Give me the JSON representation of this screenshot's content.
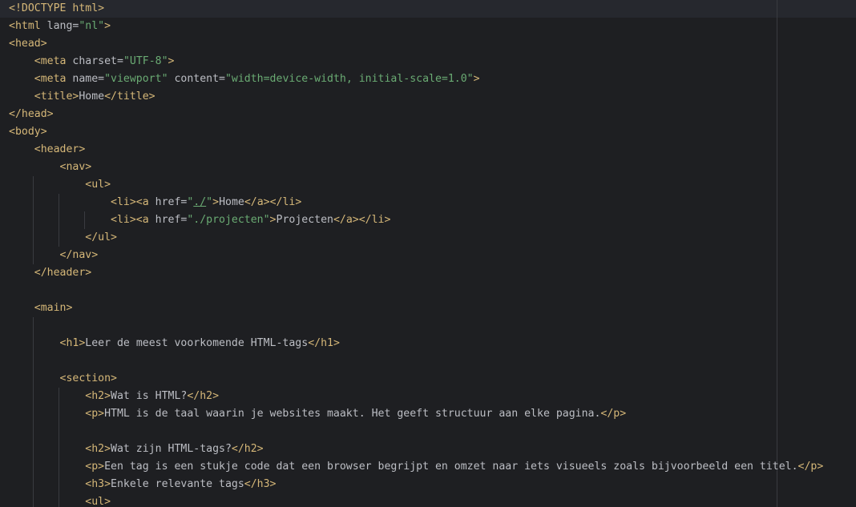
{
  "editor": {
    "language": "html",
    "colors": {
      "background": "#1e1f22",
      "current_line": "#26282e",
      "tag": "#d5b778",
      "attribute": "#bcbec4",
      "value": "#6aab73",
      "text": "#bcbec4"
    },
    "lines": [
      [
        {
          "k": "t",
          "s": "<!DOCTYPE html>"
        }
      ],
      [
        {
          "k": "t",
          "s": "<html "
        },
        {
          "k": "a",
          "s": "lang="
        },
        {
          "k": "v",
          "s": "\"nl\""
        },
        {
          "k": "t",
          "s": ">"
        }
      ],
      [
        {
          "k": "t",
          "s": "<head>"
        }
      ],
      [
        {
          "k": "x",
          "s": "    "
        },
        {
          "k": "t",
          "s": "<meta "
        },
        {
          "k": "a",
          "s": "charset="
        },
        {
          "k": "v",
          "s": "\"UTF-8\""
        },
        {
          "k": "t",
          "s": ">"
        }
      ],
      [
        {
          "k": "x",
          "s": "    "
        },
        {
          "k": "t",
          "s": "<meta "
        },
        {
          "k": "a",
          "s": "name="
        },
        {
          "k": "v",
          "s": "\"viewport\""
        },
        {
          "k": "a",
          "s": " content="
        },
        {
          "k": "v",
          "s": "\"width=device-width, initial-scale=1.0\""
        },
        {
          "k": "t",
          "s": ">"
        }
      ],
      [
        {
          "k": "x",
          "s": "    "
        },
        {
          "k": "t",
          "s": "<title>"
        },
        {
          "k": "x",
          "s": "Home"
        },
        {
          "k": "t",
          "s": "</title>"
        }
      ],
      [
        {
          "k": "t",
          "s": "</head>"
        }
      ],
      [
        {
          "k": "t",
          "s": "<body>"
        }
      ],
      [
        {
          "k": "x",
          "s": "    "
        },
        {
          "k": "t",
          "s": "<header>"
        }
      ],
      [
        {
          "k": "x",
          "s": "        "
        },
        {
          "k": "t",
          "s": "<nav>"
        }
      ],
      [
        {
          "k": "x",
          "s": "            "
        },
        {
          "k": "t",
          "s": "<ul>"
        }
      ],
      [
        {
          "k": "x",
          "s": "                "
        },
        {
          "k": "t",
          "s": "<li><a "
        },
        {
          "k": "a",
          "s": "href="
        },
        {
          "k": "v",
          "s": "\""
        },
        {
          "k": "v u",
          "s": "./"
        },
        {
          "k": "v",
          "s": "\""
        },
        {
          "k": "t",
          "s": ">"
        },
        {
          "k": "x",
          "s": "Home"
        },
        {
          "k": "t",
          "s": "</a></li>"
        }
      ],
      [
        {
          "k": "x",
          "s": "                "
        },
        {
          "k": "t",
          "s": "<li><a "
        },
        {
          "k": "a",
          "s": "href="
        },
        {
          "k": "v",
          "s": "\"./projecten\""
        },
        {
          "k": "t",
          "s": ">"
        },
        {
          "k": "x",
          "s": "Projecten"
        },
        {
          "k": "t",
          "s": "</a></li>"
        }
      ],
      [
        {
          "k": "x",
          "s": "            "
        },
        {
          "k": "t",
          "s": "</ul>"
        }
      ],
      [
        {
          "k": "x",
          "s": "        "
        },
        {
          "k": "t",
          "s": "</nav>"
        }
      ],
      [
        {
          "k": "x",
          "s": "    "
        },
        {
          "k": "t",
          "s": "</header>"
        }
      ],
      [],
      [
        {
          "k": "x",
          "s": "    "
        },
        {
          "k": "t",
          "s": "<main>"
        }
      ],
      [],
      [
        {
          "k": "x",
          "s": "        "
        },
        {
          "k": "t",
          "s": "<h1>"
        },
        {
          "k": "x",
          "s": "Leer de meest voorkomende HTML-tags"
        },
        {
          "k": "t",
          "s": "</h1>"
        }
      ],
      [],
      [
        {
          "k": "x",
          "s": "        "
        },
        {
          "k": "t",
          "s": "<section>"
        }
      ],
      [
        {
          "k": "x",
          "s": "            "
        },
        {
          "k": "t",
          "s": "<h2>"
        },
        {
          "k": "x",
          "s": "Wat is HTML?"
        },
        {
          "k": "t",
          "s": "</h2>"
        }
      ],
      [
        {
          "k": "x",
          "s": "            "
        },
        {
          "k": "t",
          "s": "<p>"
        },
        {
          "k": "x",
          "s": "HTML is de taal waarin je websites maakt. Het geeft structuur aan elke pagina."
        },
        {
          "k": "t",
          "s": "</p>"
        }
      ],
      [],
      [
        {
          "k": "x",
          "s": "            "
        },
        {
          "k": "t",
          "s": "<h2>"
        },
        {
          "k": "x",
          "s": "Wat zijn HTML-tags?"
        },
        {
          "k": "t",
          "s": "</h2>"
        }
      ],
      [
        {
          "k": "x",
          "s": "            "
        },
        {
          "k": "t",
          "s": "<p>"
        },
        {
          "k": "x",
          "s": "Een tag is een stukje code dat een browser begrijpt en omzet naar iets visueels zoals bijvoorbeeld een titel."
        },
        {
          "k": "t",
          "s": "</p>"
        }
      ],
      [
        {
          "k": "x",
          "s": "            "
        },
        {
          "k": "t",
          "s": "<h3>"
        },
        {
          "k": "x",
          "s": "Enkele relevante tags"
        },
        {
          "k": "t",
          "s": "</h3>"
        }
      ],
      [
        {
          "k": "x",
          "s": "            "
        },
        {
          "k": "t",
          "s": "<ul>"
        }
      ]
    ]
  }
}
